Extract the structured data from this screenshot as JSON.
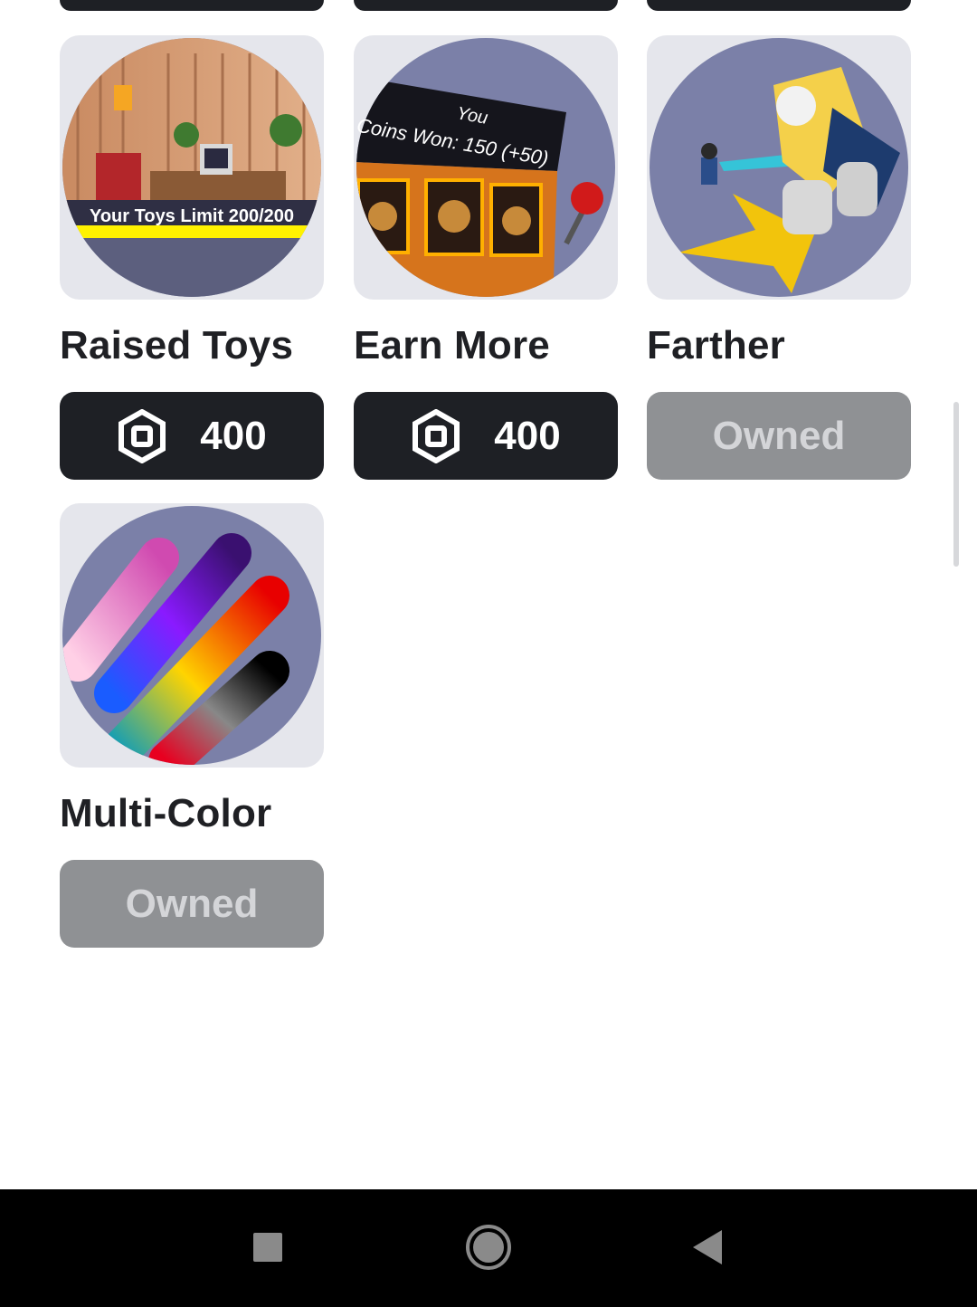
{
  "items": [
    {
      "name": "Raised Toys",
      "price": "400",
      "owned": false,
      "thumb_text": "Your Toys Limit 200/200",
      "icon": "robux-icon"
    },
    {
      "name": "Earn More",
      "price": "400",
      "owned": false,
      "thumb_text_line1": "You",
      "thumb_text_line2": "Coins Won: 150 (+50)",
      "icon": "robux-icon"
    },
    {
      "name": "Farther",
      "owned": true,
      "status": "Owned"
    },
    {
      "name": "Multi-Color",
      "owned": true,
      "status": "Owned"
    }
  ],
  "nav": {
    "recents": "square-icon",
    "home": "circle-icon",
    "back": "triangle-back-icon"
  },
  "colors": {
    "buy_button": "#1e2025",
    "owned_button": "#8f9194",
    "owned_text": "#d4d5d8",
    "thumb_bg": "#e5e6ec",
    "thumb_circle": "#7b80a8"
  }
}
